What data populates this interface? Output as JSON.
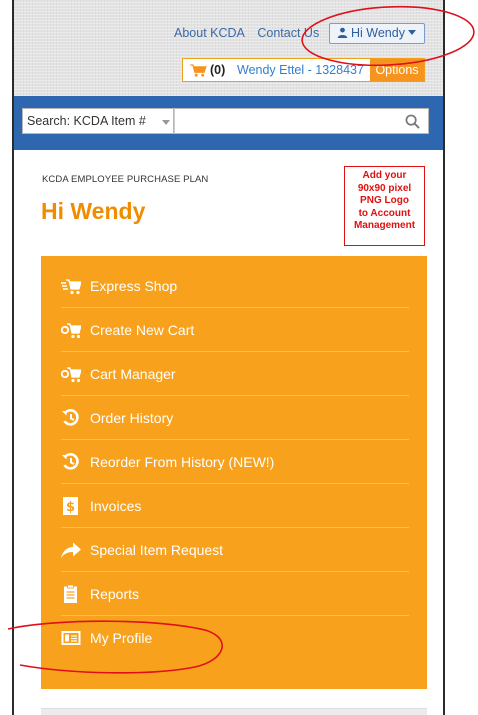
{
  "header": {
    "links": [
      "About KCDA",
      "Contact Us"
    ],
    "user_menu": {
      "label": "Hi Wendy",
      "icon": "person-icon"
    },
    "cart": {
      "count": "(0)",
      "user": "Wendy Ettel - 1328437",
      "options_label": "Options"
    }
  },
  "search": {
    "scope": "Search: KCDA Item #",
    "query": "",
    "icon": "search-icon"
  },
  "page": {
    "plan_label": "KCDA EMPLOYEE PURCHASE PLAN",
    "greeting": "Hi Wendy",
    "logo_placeholder": [
      "Add your",
      "90x90 pixel",
      "PNG Logo",
      "to Account",
      "Management"
    ]
  },
  "menu": {
    "items": [
      {
        "label": "Express Shop",
        "icon": "express-cart-icon"
      },
      {
        "label": "Create New Cart",
        "icon": "cart-plus-icon"
      },
      {
        "label": "Cart Manager",
        "icon": "cart-key-icon"
      },
      {
        "label": "Order History",
        "icon": "history-icon"
      },
      {
        "label": "Reorder From History (NEW!)",
        "icon": "history-icon"
      },
      {
        "label": "Invoices",
        "icon": "invoice-dollar-icon"
      },
      {
        "label": "Special Item Request",
        "icon": "share-arrow-icon"
      },
      {
        "label": "Reports",
        "icon": "clipboard-icon"
      },
      {
        "label": "My Profile",
        "icon": "id-card-icon"
      }
    ]
  },
  "colors": {
    "menu_orange": "#f7a11c",
    "greeting_orange": "#f08c00",
    "search_bar_blue": "#2f66b0",
    "link_blue": "#3a6aa8",
    "annotation_red": "#e0101b"
  }
}
